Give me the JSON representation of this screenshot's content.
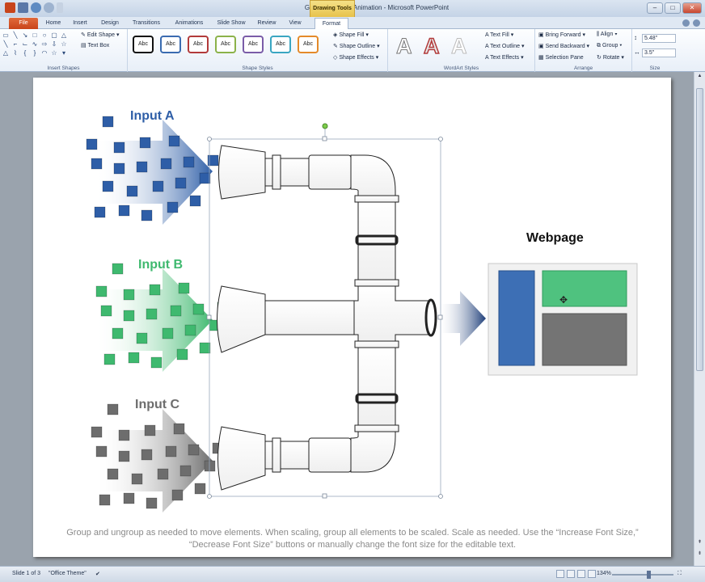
{
  "window": {
    "title": "GMG_Graphics_Animation - Microsoft PowerPoint",
    "contextual_tab": "Drawing Tools"
  },
  "tabs": [
    "File",
    "Home",
    "Insert",
    "Design",
    "Transitions",
    "Animations",
    "Slide Show",
    "Review",
    "View",
    "Format"
  ],
  "active_tab": "Format",
  "ribbon": {
    "insert_shapes": {
      "label": "Insert Shapes",
      "edit_shape": "Edit Shape",
      "text_box": "Text Box"
    },
    "shape_styles": {
      "label": "Shape Styles",
      "style_text": "Abc",
      "shape_fill": "Shape Fill",
      "shape_outline": "Shape Outline",
      "shape_effects": "Shape Effects"
    },
    "wordart_styles": {
      "label": "WordArt Styles",
      "text_fill": "Text Fill",
      "text_outline": "Text Outline",
      "text_effects": "Text Effects"
    },
    "arrange": {
      "label": "Arrange",
      "bring_forward": "Bring Forward",
      "send_backward": "Send Backward",
      "selection_pane": "Selection Pane",
      "align": "Align",
      "group": "Group",
      "rotate": "Rotate"
    },
    "size": {
      "label": "Size",
      "height": "5.48\"",
      "width": "3.5\""
    }
  },
  "slide": {
    "input_a": "Input A",
    "input_b": "Input B",
    "input_c": "Input C",
    "webpage": "Webpage",
    "caption": "Group and ungroup as needed to move elements. When scaling, group all elements to be scaled. Scale as needed. Use the “Increase Font Size,” “Decrease Font Size” buttons or manually change the font size for the editable text."
  },
  "colors": {
    "blue": "#2e5ea7",
    "green": "#3fb96f",
    "gray": "#6d6d6d",
    "navy": "#1d3d78",
    "accent_file": "#d9541e"
  },
  "status": {
    "slide": "Slide 1 of 3",
    "theme": "\"Office Theme\"",
    "zoom": "134%"
  }
}
